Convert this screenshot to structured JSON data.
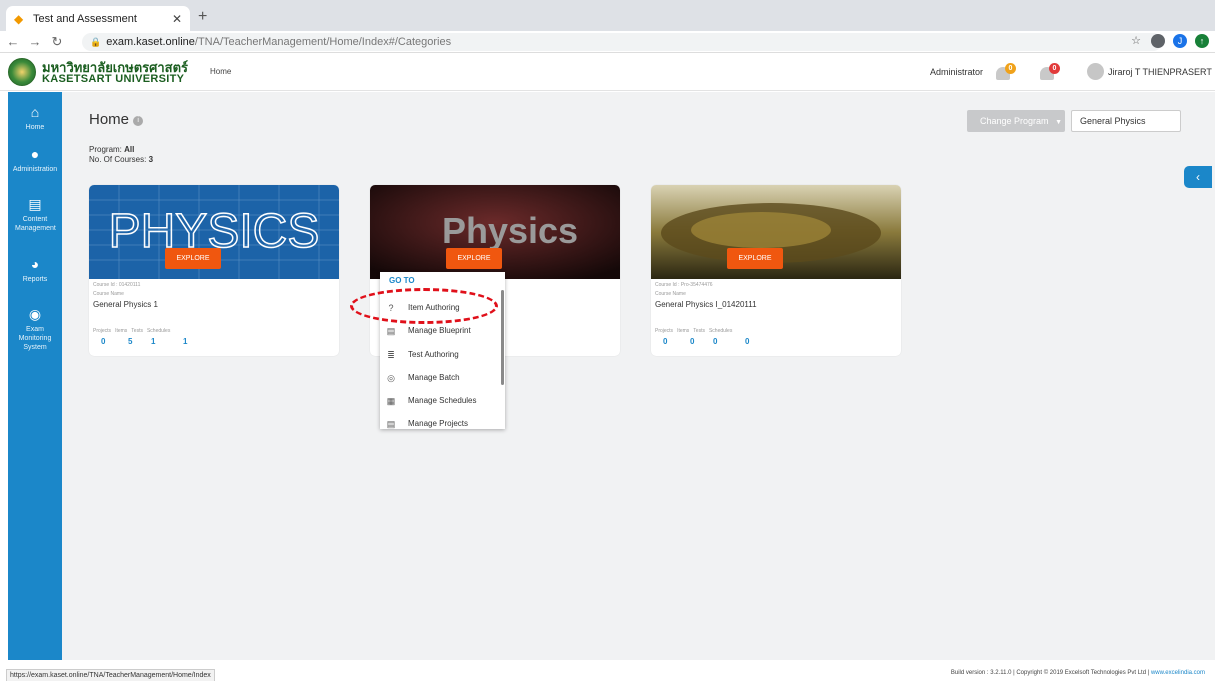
{
  "browser": {
    "tab_title": "Test and Assessment",
    "url_host": "exam.kaset.online",
    "url_path": "/TNA/TeacherManagement/Home/Index#/Categories",
    "status_url": "https://exam.kaset.online/TNA/TeacherManagement/Home/Index",
    "profile_initial": "J"
  },
  "header": {
    "logo_thai": "มหาวิทยาลัยเกษตรศาสตร์",
    "logo_en": "KASETSART UNIVERSITY",
    "home_link": "Home",
    "role": "Administrator",
    "alert_badge": "0",
    "notification_badge": "0",
    "user_name": "Jiraroj  T THIENPRASERT"
  },
  "sidebar": {
    "items": [
      {
        "label": "Home",
        "icon": "home-icon"
      },
      {
        "label": "Administration",
        "icon": "user-icon"
      },
      {
        "label": "Content Management",
        "icon": "document-icon"
      },
      {
        "label": "Reports",
        "icon": "pie-chart-icon"
      },
      {
        "label": "Exam Monitoring System",
        "icon": "dashboard-icon"
      }
    ]
  },
  "main": {
    "title": "Home",
    "program_label": "Program:",
    "program_value": "All",
    "courses_label": "No. Of Courses:",
    "courses_value": "3",
    "change_program": "Change Program",
    "program_input": "General Physics"
  },
  "cards": [
    {
      "banner_text": "PHYSICS",
      "explore": "EXPLORE",
      "course_id": "Course Id : 01420111",
      "course_name_label": "Course Name",
      "course_name": "General Physics 1",
      "stat_labels": [
        "Projects",
        "Items",
        "Tests",
        "Schedules"
      ],
      "stats": [
        "0",
        "5",
        "1",
        "1"
      ]
    },
    {
      "banner_text": "Physics",
      "explore": "EXPLORE",
      "course_id": "",
      "course_name_label": "",
      "course_name": "",
      "stat_labels": [],
      "stats": []
    },
    {
      "banner_text": "",
      "explore": "EXPLORE",
      "course_id": "Course Id : Pro-35474476",
      "course_name_label": "Course Name",
      "course_name": "General Physics I_01420111",
      "stat_labels": [
        "Projects",
        "Items",
        "Tests",
        "Schedules"
      ],
      "stats": [
        "0",
        "0",
        "0",
        "0"
      ]
    }
  ],
  "goto_menu": {
    "title": "GO TO",
    "items": [
      {
        "label": "Item Authoring",
        "icon": "question-icon"
      },
      {
        "label": "Manage Blueprint",
        "icon": "clipboard-icon"
      },
      {
        "label": "Test Authoring",
        "icon": "list-icon"
      },
      {
        "label": "Manage Batch",
        "icon": "batch-icon"
      },
      {
        "label": "Manage Schedules",
        "icon": "calendar-icon"
      },
      {
        "label": "Manage Projects",
        "icon": "projects-icon"
      }
    ]
  },
  "footer": {
    "text": "Build version : 3.2.11.0 | Copyright © 2019 Excelsoft Technologies Pvt Ltd | ",
    "link": "www.excelindia.com"
  }
}
